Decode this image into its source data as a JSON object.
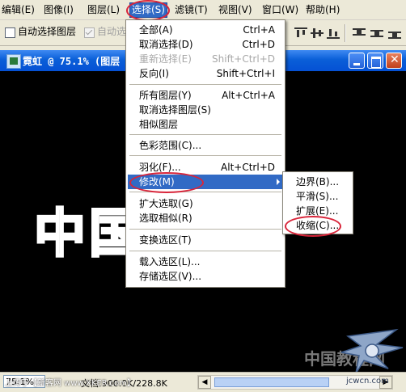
{
  "menubar": {
    "items": [
      "编辑(E)",
      "图像(I)",
      "图层(L)",
      "选择(S)",
      "滤镜(T)",
      "视图(V)",
      "窗口(W)",
      "帮助(H)"
    ],
    "active_index": 3
  },
  "options": {
    "auto_select_layer": "自动选择图层",
    "auto_select_group": "自动选"
  },
  "document": {
    "title": "霓虹 @ 75.1% (图层"
  },
  "canvas_text": {
    "big": "中国",
    "watermark": "中国教程网"
  },
  "status": {
    "zoom": "75.1%",
    "doc_info": "文档:900.0K/228.8K",
    "credit_left": "上传于【新客网 www.XKER.com】",
    "credit_right": "jcwcn.com"
  },
  "select_menu": {
    "items": [
      {
        "label": "全部(A)",
        "shortcut": "Ctrl+A"
      },
      {
        "label": "取消选择(D)",
        "shortcut": "Ctrl+D"
      },
      {
        "label": "重新选择(E)",
        "shortcut": "Shift+Ctrl+D",
        "disabled": true
      },
      {
        "label": "反向(I)",
        "shortcut": "Shift+Ctrl+I"
      },
      {
        "label": "所有图层(Y)",
        "shortcut": "Alt+Ctrl+A"
      },
      {
        "label": "取消选择图层(S)",
        "shortcut": ""
      },
      {
        "label": "相似图层",
        "shortcut": ""
      },
      {
        "label": "色彩范围(C)...",
        "shortcut": ""
      },
      {
        "label": "羽化(F)...",
        "shortcut": "Alt+Ctrl+D"
      },
      {
        "label": "修改(M)",
        "shortcut": "",
        "highlighted": true
      },
      {
        "label": "扩大选取(G)",
        "shortcut": ""
      },
      {
        "label": "选取相似(R)",
        "shortcut": ""
      },
      {
        "label": "变换选区(T)",
        "shortcut": ""
      },
      {
        "label": "载入选区(L)...",
        "shortcut": ""
      },
      {
        "label": "存储选区(V)...",
        "shortcut": ""
      }
    ]
  },
  "modify_submenu": {
    "items": [
      "边界(B)...",
      "平滑(S)...",
      "扩展(E)...",
      "收缩(C)..."
    ]
  },
  "colors": {
    "highlight": "#316ac5",
    "annotation": "#d8253a",
    "titlebar": "#0a5fd8"
  }
}
